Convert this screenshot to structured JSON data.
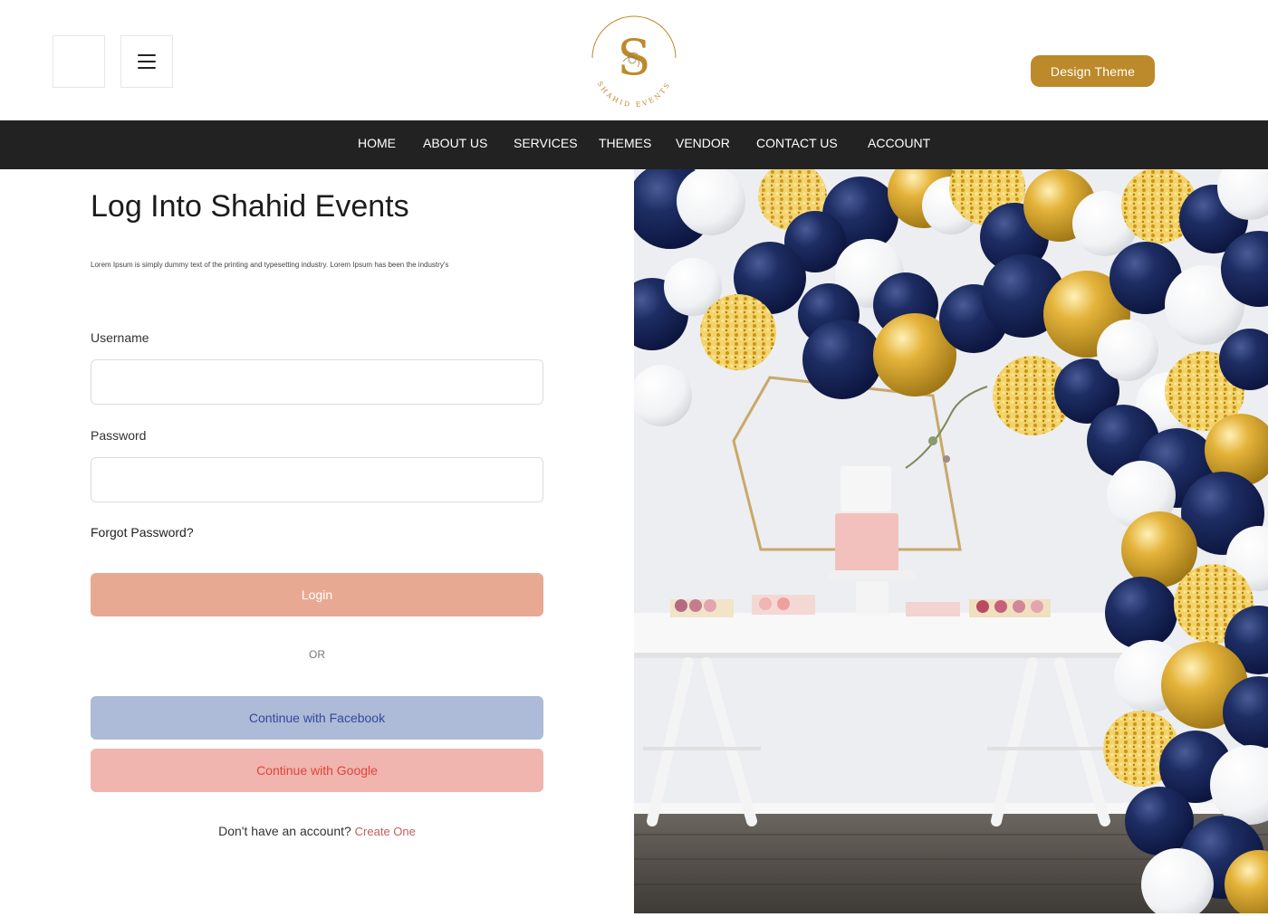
{
  "header": {
    "logo": {
      "icon": "shahid-events-logo",
      "letter": "S",
      "tagline": "SHAHID EVENTS"
    },
    "design_theme_button": "Design Theme",
    "menu_icon": "hamburger-menu-icon"
  },
  "nav": {
    "items": [
      {
        "label": "HOME"
      },
      {
        "label": "ABOUT US"
      },
      {
        "label": "SERVICES"
      },
      {
        "label": "THEMES"
      },
      {
        "label": "VENDOR"
      },
      {
        "label": "CONTACT US"
      },
      {
        "label": "ACCOUNT"
      }
    ]
  },
  "login": {
    "title": "Log Into Shahid Events",
    "subtitle": "Lorem Ipsum is simply dummy text of the printing and typesetting industry. Lorem Ipsum has been the industry's",
    "username_label": "Username",
    "username_value": "",
    "password_label": "Password",
    "password_value": "",
    "forgot_password": "Forgot Password?",
    "login_button": "Login",
    "or_text": "OR",
    "facebook_button": "Continue with Facebook",
    "google_button": "Continue with Google",
    "no_account_text": "Don't have an account?",
    "create_link": "Create One"
  },
  "colors": {
    "brand_gold": "#bc8a2a",
    "nav_bg": "#222222",
    "login_button": "#e8a993",
    "facebook_button": "#adbad8",
    "google_button": "#efb5ae"
  }
}
